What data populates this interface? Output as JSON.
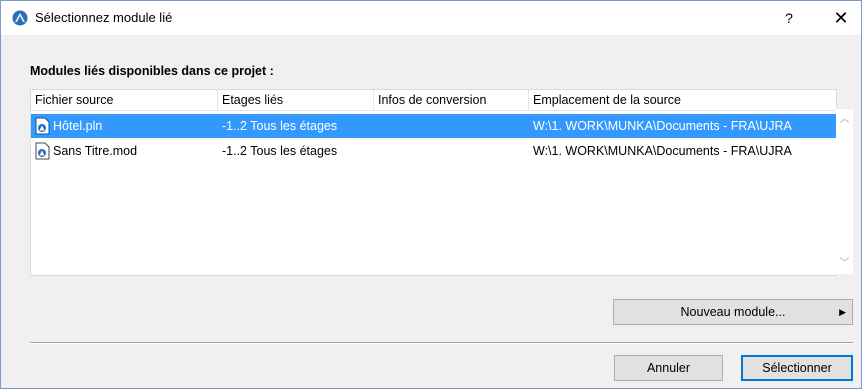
{
  "window": {
    "title": "Sélectionnez module lié",
    "help_label": "?",
    "close_label": "✕"
  },
  "section_label": "Modules liés disponibles dans ce projet :",
  "table": {
    "columns": [
      "Fichier source",
      "Etages liés",
      "Infos de conversion",
      "Emplacement de la source"
    ],
    "rows": [
      {
        "icon": "archicad-plan-file-icon",
        "file": "Hôtel.pln",
        "stories": "-1..2 Tous les étages",
        "conversion": "",
        "location": "W:\\1. WORK\\MUNKA\\Documents - FRA\\UJRA",
        "selected": true
      },
      {
        "icon": "archicad-module-file-icon",
        "file": "Sans Titre.mod",
        "stories": "-1..2 Tous les étages",
        "conversion": "",
        "location": "W:\\1. WORK\\MUNKA\\Documents - FRA\\UJRA",
        "selected": false
      }
    ]
  },
  "buttons": {
    "new_module": "Nouveau module...",
    "cancel": "Annuler",
    "select": "Sélectionner"
  },
  "colors": {
    "selection": "#3399ff",
    "default_button_border": "#0078d7"
  }
}
